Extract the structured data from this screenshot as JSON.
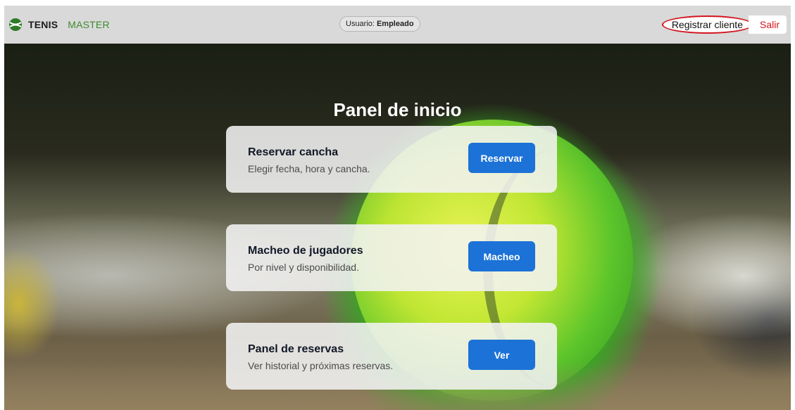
{
  "navbar": {
    "brand_primary": "TENIS",
    "brand_secondary": "MASTER",
    "logo_icon": "tennis-ball-icon",
    "user_label": "Usuario:",
    "user_role": "Empleado",
    "register_label": "Registrar cliente",
    "logout_label": "Salir"
  },
  "colors": {
    "brand_green": "#3e8a2e",
    "accent_blue": "#1c72d6",
    "danger_red": "#d4141e"
  },
  "main": {
    "title": "Panel de inicio",
    "cards": [
      {
        "title": "Reservar cancha",
        "description": "Elegir fecha, hora y cancha.",
        "button": "Reservar"
      },
      {
        "title": "Macheo de jugadores",
        "description": "Por nivel y disponibilidad.",
        "button": "Macheo"
      },
      {
        "title": "Panel de reservas",
        "description": "Ver historial y próximas reservas.",
        "button": "Ver"
      }
    ]
  }
}
